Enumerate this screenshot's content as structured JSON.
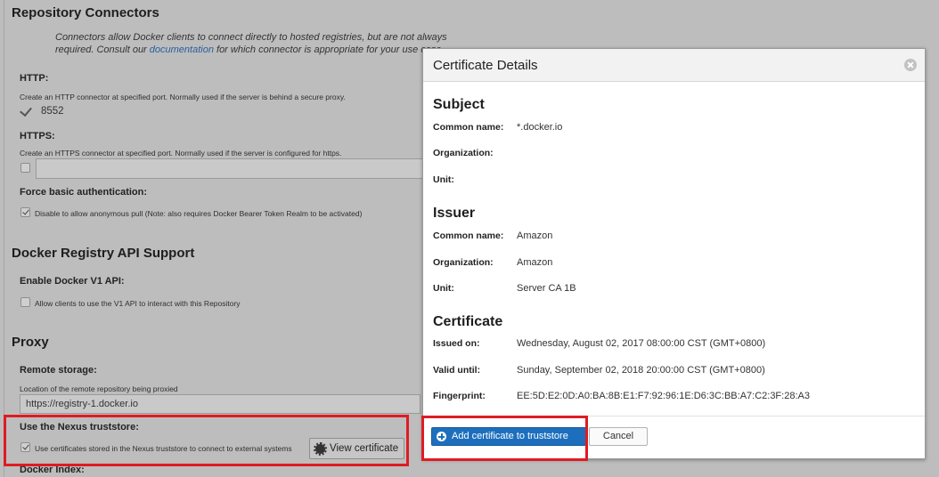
{
  "background_form": {
    "repository_connectors": {
      "heading": "Repository Connectors",
      "intro_before_link": "Connectors allow Docker clients to connect directly to hosted registries, but are not always required. Consult our ",
      "intro_link": "documentation",
      "intro_after_link": " for which connector is appropriate for your use case."
    },
    "http": {
      "label": "HTTP:",
      "help": "Create an HTTP connector at specified port. Normally used if the server is behind a secure proxy.",
      "checked": true,
      "value": "8552"
    },
    "https": {
      "label": "HTTPS:",
      "help": "Create an HTTPS connector at specified port. Normally used if the server is configured for https.",
      "checked": false,
      "value": ""
    },
    "force_basic_auth": {
      "label": "Force basic authentication:",
      "checkbox_label": "Disable to allow anonymous pull (Note: also requires Docker Bearer Token Realm to be activated)",
      "checked": true
    },
    "docker_registry_api": {
      "heading": "Docker Registry API Support",
      "v1_label": "Enable Docker V1 API:",
      "v1_checkbox_label": "Allow clients to use the V1 API to interact with this Repository",
      "v1_checked": false
    },
    "proxy": {
      "heading": "Proxy",
      "remote_storage_label": "Remote storage:",
      "remote_storage_help": "Location of the remote repository being proxied",
      "remote_storage_value": "https://registry-1.docker.io",
      "truststore_label": "Use the Nexus truststore:",
      "truststore_checkbox_label": "Use certificates stored in the Nexus truststore to connect to external systems",
      "truststore_checked": true,
      "view_certificate_label": "View certificate",
      "docker_index_label": "Docker Index:"
    }
  },
  "dialog": {
    "title": "Certificate Details",
    "subject": {
      "heading": "Subject",
      "common_name_label": "Common name:",
      "common_name": "*.docker.io",
      "organization_label": "Organization:",
      "organization": "",
      "unit_label": "Unit:",
      "unit": ""
    },
    "issuer": {
      "heading": "Issuer",
      "common_name_label": "Common name:",
      "common_name": "Amazon",
      "organization_label": "Organization:",
      "organization": "Amazon",
      "unit_label": "Unit:",
      "unit": "Server CA 1B"
    },
    "certificate": {
      "heading": "Certificate",
      "issued_on_label": "Issued on:",
      "issued_on": "Wednesday, August 02, 2017 08:00:00 CST (GMT+0800)",
      "valid_until_label": "Valid until:",
      "valid_until": "Sunday, September 02, 2018 20:00:00 CST (GMT+0800)",
      "fingerprint_label": "Fingerprint:",
      "fingerprint": "EE:5D:E2:0D:A0:BA:8B:E1:F7:92:96:1E:D6:3C:BB:A7:C2:3F:28:A3"
    },
    "add_button_label": "Add certificate to truststore",
    "cancel_button_label": "Cancel"
  },
  "colors": {
    "overlay_background": "#bdbdbd",
    "primary_button": "#1d6fbd",
    "highlight_border": "#e01b22",
    "link": "#2a5d9b"
  },
  "icons": {
    "close": "close-circle-icon",
    "add": "plus-circle-icon",
    "view_certificate": "certificate-seal-icon"
  }
}
